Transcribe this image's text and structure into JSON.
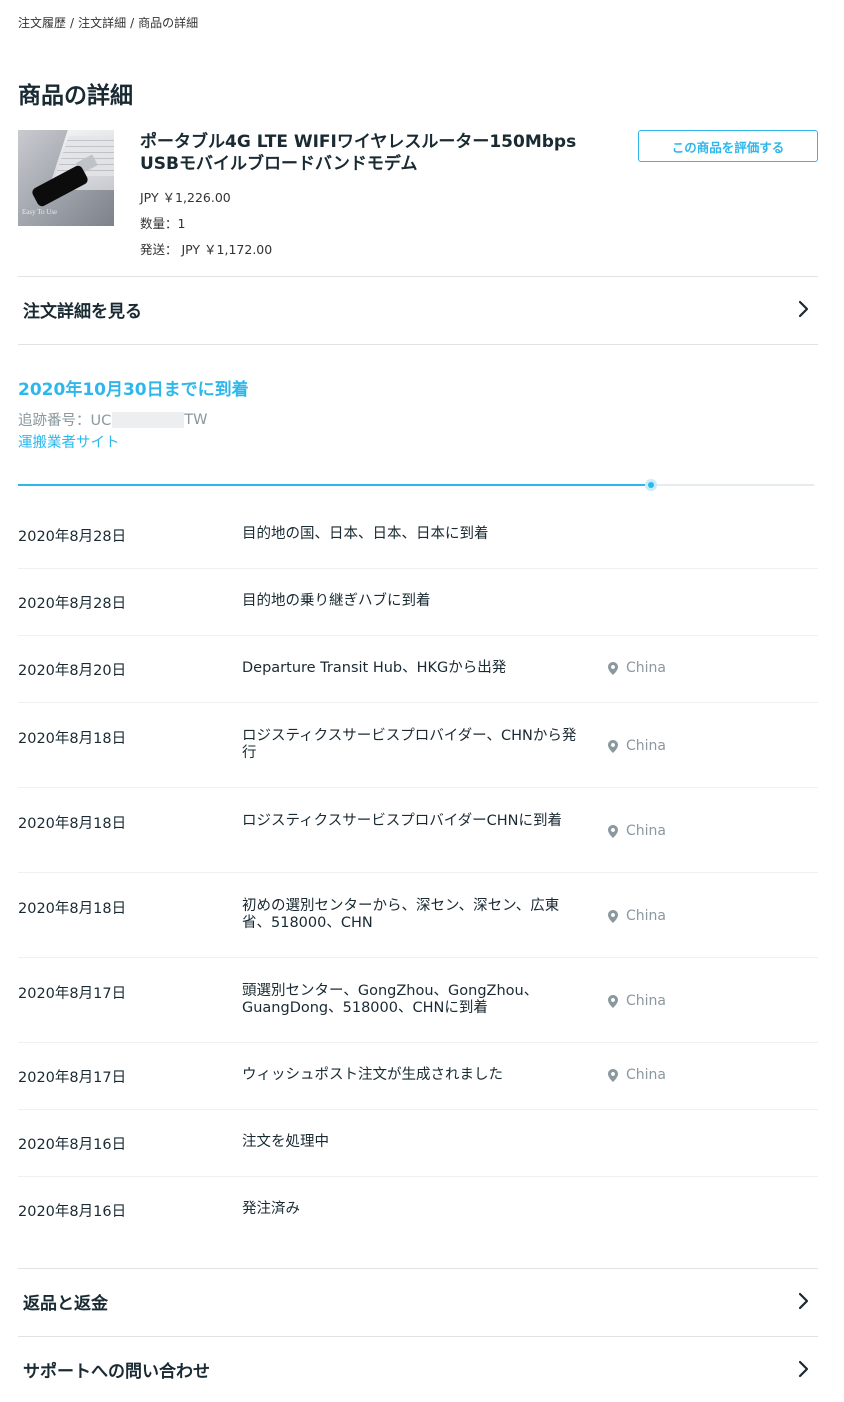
{
  "breadcrumb": {
    "items": [
      "注文履歴",
      "注文詳細",
      "商品の詳細"
    ],
    "separator": "/"
  },
  "page": {
    "title": "商品の詳細"
  },
  "product": {
    "image_alt": "USB 4G LTE dongle on laptop",
    "image_watermark": "Easy To Use",
    "title": "ポータブル4G LTE WIFIワイヤレスルーター150Mbps USBモバイルブロードバンドモデム",
    "price": "JPY ￥1,226.00",
    "quantity": "数量：1",
    "shipping": "発送： JPY ￥1,172.00",
    "rate_button": "この商品を評価する"
  },
  "order_details_link": {
    "label": "注文詳細を見る",
    "icon": "chevron-right-icon"
  },
  "delivery": {
    "title": "2020年10月30日までに到着",
    "tracking_prefix": "追跡番号：UC",
    "tracking_suffix": "TW",
    "carrier_link": "運搬業者サイト",
    "progress_fraction": 0.795
  },
  "events": [
    {
      "date": "2020年8月28日",
      "desc": "目的地の国、日本、日本、日本に到着",
      "location": ""
    },
    {
      "date": "2020年8月28日",
      "desc": "目的地の乗り継ぎハブに到着",
      "location": ""
    },
    {
      "date": "2020年8月20日",
      "desc": "Departure Transit Hub、HKGから出発",
      "location": "China"
    },
    {
      "date": "2020年8月18日",
      "desc": "ロジスティクスサービスプロバイダー、CHNから発行",
      "location": "China"
    },
    {
      "date": "2020年8月18日",
      "desc": "ロジスティクスサービスプロバイダーCHNに到着",
      "location": "China"
    },
    {
      "date": "2020年8月18日",
      "desc": "初めの選別センターから、深セン、深セン、広東省、518000、CHN",
      "location": "China"
    },
    {
      "date": "2020年8月17日",
      "desc": "頭選別センター、GongZhou、GongZhou、GuangDong、518000、CHNに到着",
      "location": "China"
    },
    {
      "date": "2020年8月17日",
      "desc": "ウィッシュポスト注文が生成されました",
      "location": "China"
    },
    {
      "date": "2020年8月16日",
      "desc": "注文を処理中",
      "location": ""
    },
    {
      "date": "2020年8月16日",
      "desc": "発注済み",
      "location": ""
    }
  ],
  "footer_links": {
    "returns": "返品と返金",
    "support": "サポートへの問い合わせ"
  },
  "colors": {
    "accent": "#2fb7ec",
    "text": "#192a32",
    "muted": "#8b98a0",
    "divider": "#dfe3e6"
  }
}
